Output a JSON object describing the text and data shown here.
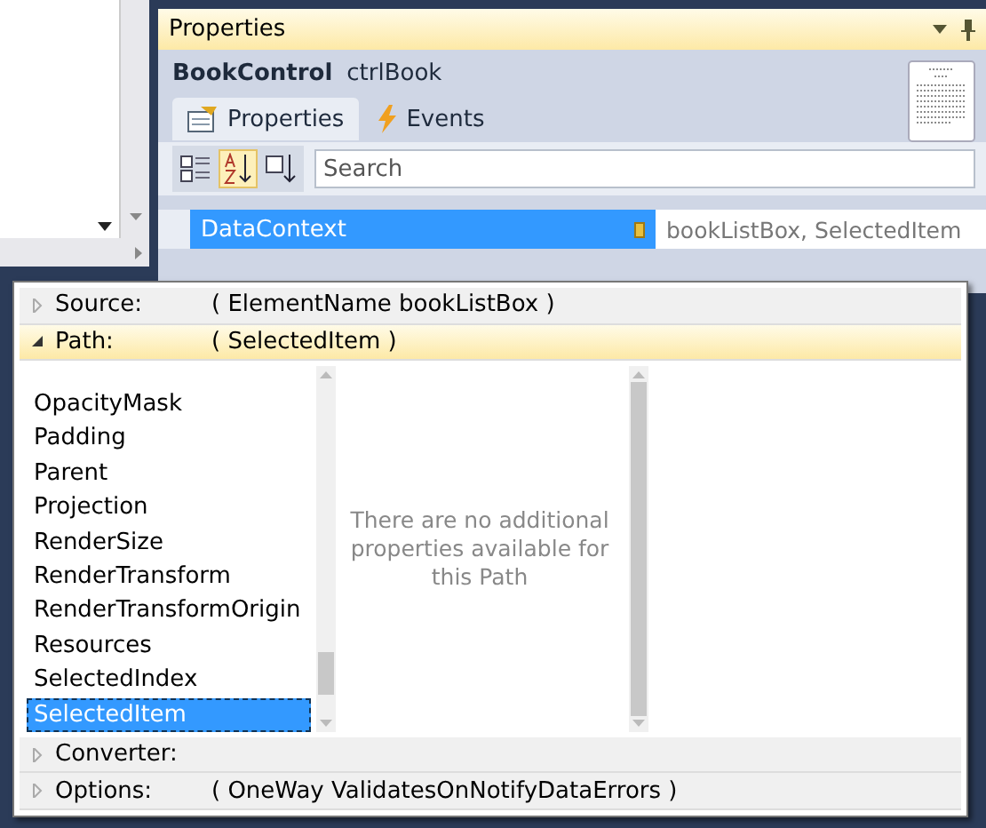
{
  "panel": {
    "title": "Properties",
    "object_type": "BookControl",
    "object_name": "ctrlBook"
  },
  "tabs": [
    {
      "label": "Properties",
      "selected": true,
      "kind": "properties"
    },
    {
      "label": "Events",
      "selected": false,
      "kind": "events"
    }
  ],
  "toolbar": [
    {
      "kind": "categorize",
      "selected": false
    },
    {
      "kind": "alphabetical",
      "selected": true
    },
    {
      "kind": "source",
      "selected": false
    }
  ],
  "search": {
    "placeholder": "Search"
  },
  "property_row": {
    "name": "DataContext",
    "value": "bookListBox, SelectedItem",
    "selected": true
  },
  "binding_editor": {
    "sections_top": [
      {
        "label": "Source:",
        "value": "( ElementName bookListBox )",
        "expanded": false
      },
      {
        "label": "Path:",
        "value": "( SelectedItem )",
        "expanded": true
      }
    ],
    "path_items": [
      {
        "label": "OpacityMask",
        "selected": false
      },
      {
        "label": "Padding",
        "selected": false
      },
      {
        "label": "Parent",
        "selected": false
      },
      {
        "label": "Projection",
        "selected": false
      },
      {
        "label": "RenderSize",
        "selected": false
      },
      {
        "label": "RenderTransform",
        "selected": false
      },
      {
        "label": "RenderTransformOrigin",
        "selected": false
      },
      {
        "label": "Resources",
        "selected": false
      },
      {
        "label": "SelectedIndex",
        "selected": false
      },
      {
        "label": "SelectedItem",
        "selected": true
      }
    ],
    "message": "There are no additional properties available for this Path",
    "sections_bottom": [
      {
        "label": "Converter:",
        "expanded": false
      },
      {
        "label": "Options:",
        "value": "( OneWay ValidatesOnNotifyDataErrors )",
        "expanded": false
      }
    ]
  }
}
